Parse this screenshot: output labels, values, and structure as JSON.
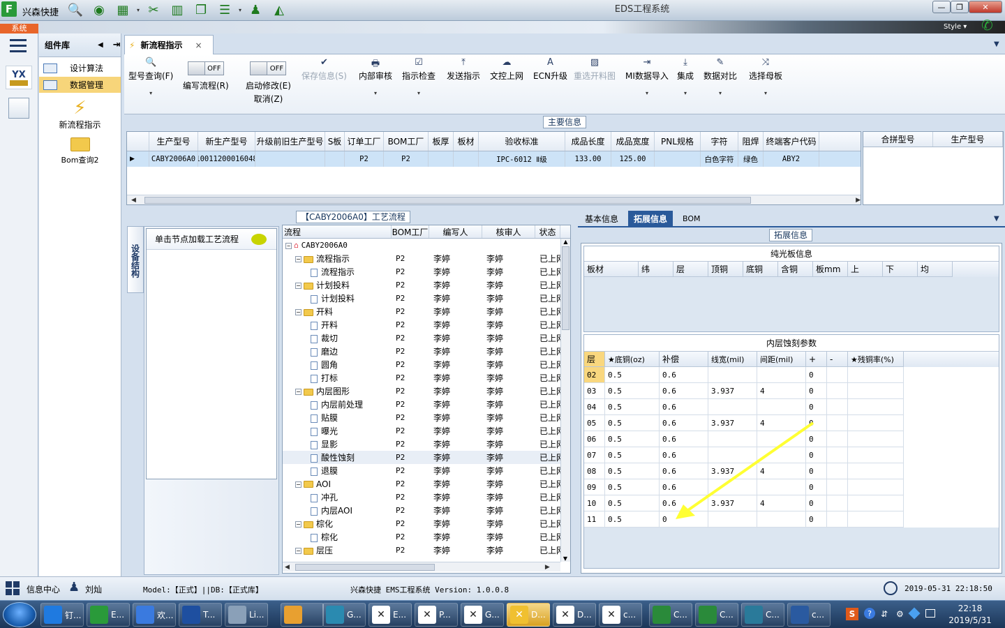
{
  "app": {
    "name": "兴森快捷",
    "window_title": "EDS工程系统",
    "style_label": "Style",
    "system_tab": "系统"
  },
  "toolbar_icons": [
    "search-icon",
    "globe-icon",
    "grid-icon",
    "scissors-icon",
    "film-icon",
    "copy-icon",
    "list-icon",
    "user-icon",
    "chart-icon"
  ],
  "left_rail": {
    "logo": "YX"
  },
  "component_panel": {
    "title": "组件库",
    "items": [
      {
        "label": "设计算法"
      },
      {
        "label": "数据管理"
      }
    ],
    "big_items": [
      {
        "label": "新流程指示"
      },
      {
        "label": "Bom查询2"
      }
    ]
  },
  "doc_tab": {
    "label": "新流程指示"
  },
  "ribbon": {
    "buttons": [
      {
        "label": "型号查询(F)",
        "icon": "search-icon",
        "enabled": true
      },
      {
        "label": "保存信息(S)",
        "icon": "check-icon",
        "enabled": false
      },
      {
        "label": "内部审核",
        "icon": "print-icon",
        "enabled": true
      },
      {
        "label": "指示检查",
        "icon": "check-box-icon",
        "enabled": true
      },
      {
        "label": "发送指示",
        "icon": "upload-icon",
        "enabled": true
      },
      {
        "label": "文控上网",
        "icon": "cloud-upload-icon",
        "enabled": true
      },
      {
        "label": "ECN升级",
        "icon": "ecn-icon",
        "enabled": true
      },
      {
        "label": "重选开料图",
        "icon": "image-icon",
        "enabled": false
      },
      {
        "label": "MI数据导入",
        "icon": "import-icon",
        "enabled": true
      },
      {
        "label": "集成",
        "icon": "download-icon",
        "enabled": true
      },
      {
        "label": "数据对比",
        "icon": "compare-icon",
        "enabled": true
      },
      {
        "label": "选择母板",
        "icon": "shuffle-icon",
        "enabled": true
      }
    ],
    "toggles": [
      {
        "label": "编写流程(R)",
        "state": "OFF"
      },
      {
        "label": "启动修改(E)",
        "sub": "取消(Z)",
        "state": "OFF"
      }
    ]
  },
  "main_info": {
    "title": "主要信息",
    "columns": [
      "生产型号",
      "新生产型号",
      "升级前旧生产型号",
      "S板",
      "订单工厂",
      "BOM工厂",
      "板厚",
      "板材",
      "验收标准",
      "成品长度",
      "成品宽度",
      "PNL规格",
      "字符",
      "阻焊",
      "终端客户代码"
    ],
    "side_columns": [
      "合拼型号",
      "生产型号"
    ],
    "row": [
      "CABY2006A0",
      "10011200016048",
      "",
      "",
      "P2",
      "P2",
      "",
      "",
      "IPC-6012 Ⅱ级",
      "133.00",
      "125.00",
      "",
      "白色字符",
      "绿色",
      "ABY2"
    ]
  },
  "process": {
    "title": "【CABY2006A0】工艺流程",
    "vertical_tab": "设备结构",
    "hint": "单击节点加载工艺流程",
    "columns": [
      "流程",
      "BOM工厂",
      "编写人",
      "核审人",
      "状态"
    ],
    "root": "CABY2006A0",
    "rows": [
      {
        "name": "流程指示",
        "level": 1,
        "folder": true,
        "bom": "P2",
        "writer": "李婷",
        "reviewer": "李婷",
        "status": "已上网"
      },
      {
        "name": "流程指示",
        "level": 2,
        "folder": false,
        "bom": "P2",
        "writer": "李婷",
        "reviewer": "李婷",
        "status": "已上网"
      },
      {
        "name": "计划投料",
        "level": 1,
        "folder": true,
        "bom": "P2",
        "writer": "李婷",
        "reviewer": "李婷",
        "status": "已上网"
      },
      {
        "name": "计划投料",
        "level": 2,
        "folder": false,
        "bom": "P2",
        "writer": "李婷",
        "reviewer": "李婷",
        "status": "已上网"
      },
      {
        "name": "开料",
        "level": 1,
        "folder": true,
        "bom": "P2",
        "writer": "李婷",
        "reviewer": "李婷",
        "status": "已上网"
      },
      {
        "name": "开料",
        "level": 2,
        "folder": false,
        "bom": "P2",
        "writer": "李婷",
        "reviewer": "李婷",
        "status": "已上网"
      },
      {
        "name": "裁切",
        "level": 2,
        "folder": false,
        "bom": "P2",
        "writer": "李婷",
        "reviewer": "李婷",
        "status": "已上网"
      },
      {
        "name": "磨边",
        "level": 2,
        "folder": false,
        "bom": "P2",
        "writer": "李婷",
        "reviewer": "李婷",
        "status": "已上网"
      },
      {
        "name": "圆角",
        "level": 2,
        "folder": false,
        "bom": "P2",
        "writer": "李婷",
        "reviewer": "李婷",
        "status": "已上网"
      },
      {
        "name": "打标",
        "level": 2,
        "folder": false,
        "bom": "P2",
        "writer": "李婷",
        "reviewer": "李婷",
        "status": "已上网"
      },
      {
        "name": "内层图形",
        "level": 1,
        "folder": true,
        "bom": "P2",
        "writer": "李婷",
        "reviewer": "李婷",
        "status": "已上网"
      },
      {
        "name": "内层前处理",
        "level": 2,
        "folder": false,
        "bom": "P2",
        "writer": "李婷",
        "reviewer": "李婷",
        "status": "已上网"
      },
      {
        "name": "贴膜",
        "level": 2,
        "folder": false,
        "bom": "P2",
        "writer": "李婷",
        "reviewer": "李婷",
        "status": "已上网"
      },
      {
        "name": "曝光",
        "level": 2,
        "folder": false,
        "bom": "P2",
        "writer": "李婷",
        "reviewer": "李婷",
        "status": "已上网"
      },
      {
        "name": "显影",
        "level": 2,
        "folder": false,
        "bom": "P2",
        "writer": "李婷",
        "reviewer": "李婷",
        "status": "已上网"
      },
      {
        "name": "酸性蚀刻",
        "level": 2,
        "folder": false,
        "bom": "P2",
        "writer": "李婷",
        "reviewer": "李婷",
        "status": "已上网",
        "selected": true
      },
      {
        "name": "退膜",
        "level": 2,
        "folder": false,
        "bom": "P2",
        "writer": "李婷",
        "reviewer": "李婷",
        "status": "已上网"
      },
      {
        "name": "AOI",
        "level": 1,
        "folder": true,
        "bom": "P2",
        "writer": "李婷",
        "reviewer": "李婷",
        "status": "已上网"
      },
      {
        "name": "冲孔",
        "level": 2,
        "folder": false,
        "bom": "P2",
        "writer": "李婷",
        "reviewer": "李婷",
        "status": "已上网"
      },
      {
        "name": "内层AOI",
        "level": 2,
        "folder": false,
        "bom": "P2",
        "writer": "李婷",
        "reviewer": "李婷",
        "status": "已上网"
      },
      {
        "name": "棕化",
        "level": 1,
        "folder": true,
        "bom": "P2",
        "writer": "李婷",
        "reviewer": "李婷",
        "status": "已上网"
      },
      {
        "name": "棕化",
        "level": 2,
        "folder": false,
        "bom": "P2",
        "writer": "李婷",
        "reviewer": "李婷",
        "status": "已上网"
      },
      {
        "name": "层压",
        "level": 1,
        "folder": true,
        "bom": "P2",
        "writer": "李婷",
        "reviewer": "李婷",
        "status": "已上网"
      }
    ]
  },
  "right_tabs": {
    "tabs": [
      "基本信息",
      "拓展信息",
      "BOM"
    ],
    "active": 1,
    "section_title": "拓展信息"
  },
  "bare_board": {
    "title": "纯光板信息",
    "columns": [
      "板材",
      "纬",
      "层",
      "顶铜",
      "底铜",
      "含铜",
      "板mm",
      "上",
      "下",
      "均"
    ]
  },
  "etch": {
    "title": "内层蚀刻参数",
    "columns": [
      "层",
      "★底铜(oz)",
      "补偿",
      "线宽(mil)",
      "间距(mil)",
      "+",
      "-",
      "★残铜率(%)"
    ],
    "rows": [
      [
        "02",
        "0.5",
        "0.6",
        "",
        "",
        "0",
        "",
        ""
      ],
      [
        "03",
        "0.5",
        "0.6",
        "3.937",
        "4",
        "0",
        "",
        ""
      ],
      [
        "04",
        "0.5",
        "0.6",
        "",
        "",
        "0",
        "",
        ""
      ],
      [
        "05",
        "0.5",
        "0.6",
        "3.937",
        "4",
        "0",
        "",
        ""
      ],
      [
        "06",
        "0.5",
        "0.6",
        "",
        "",
        "0",
        "",
        ""
      ],
      [
        "07",
        "0.5",
        "0.6",
        "",
        "",
        "0",
        "",
        ""
      ],
      [
        "08",
        "0.5",
        "0.6",
        "3.937",
        "4",
        "0",
        "",
        ""
      ],
      [
        "09",
        "0.5",
        "0.6",
        "",
        "",
        "0",
        "",
        ""
      ],
      [
        "10",
        "0.5",
        "0.6",
        "3.937",
        "4",
        "0",
        "",
        ""
      ],
      [
        "11",
        "0.5",
        "0",
        "",
        "",
        "0",
        "",
        ""
      ]
    ]
  },
  "annotation": {
    "color": "#ffff33"
  },
  "status_bar": {
    "info_center": "信息中心",
    "user": "刘灿",
    "model": "Model:【正式】||DB:【正式库】",
    "version": "兴森快捷 EMS工程系统 Version: 1.0.0.8",
    "datetime": "2019-05-31 22:18:50"
  },
  "taskbar": {
    "items": [
      "钉...",
      "E...",
      "欢...",
      "T...",
      "Li...",
      "",
      "G...",
      "E...",
      "P...",
      "G...",
      "D...",
      "D...",
      "c...",
      "C...",
      "C...",
      "C...",
      "c..."
    ],
    "time": "22:18",
    "date": "2019/5/31"
  }
}
